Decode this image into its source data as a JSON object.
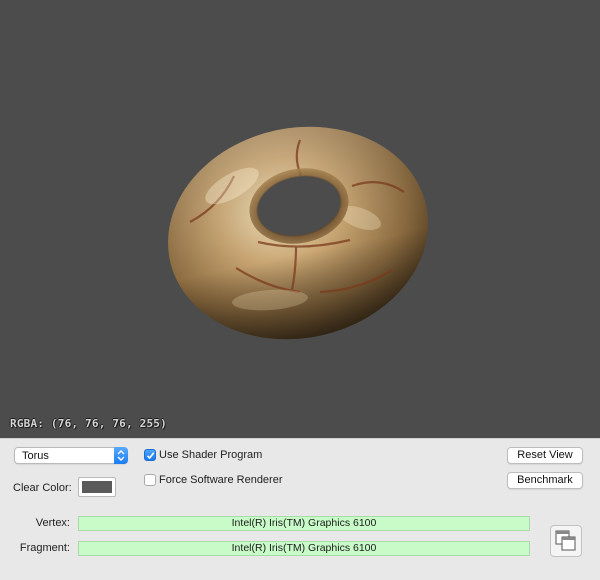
{
  "viewport": {
    "background": "#4c4c4c",
    "rgba_readout": "RGBA: (76, 76, 76, 255)"
  },
  "controls": {
    "shape_popup": {
      "selected": "Torus"
    },
    "use_shader": {
      "label": "Use Shader Program",
      "checked": true
    },
    "force_software": {
      "label": "Force Software Renderer",
      "checked": false
    },
    "clear_color": {
      "label": "Clear Color:",
      "value": "#5a5a5a"
    },
    "reset_view_label": "Reset View",
    "benchmark_label": "Benchmark",
    "vertex": {
      "label": "Vertex:",
      "value": "Intel(R) Iris(TM) Graphics 6100"
    },
    "fragment": {
      "label": "Fragment:",
      "value": "Intel(R) Iris(TM) Graphics 6100"
    },
    "window_icon": "window-stack-icon"
  }
}
